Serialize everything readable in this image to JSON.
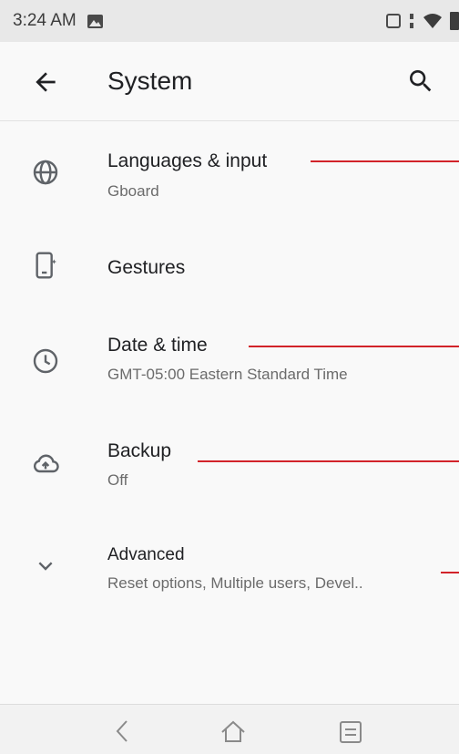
{
  "status_bar": {
    "time": "3:24 AM",
    "icons": [
      "image-notification-icon",
      "nfc-icon",
      "data-sync-icon",
      "wifi-icon",
      "battery-icon"
    ]
  },
  "app_bar": {
    "title": "System",
    "back_icon": "arrow-left-icon",
    "search_icon": "search-icon"
  },
  "settings": {
    "items": [
      {
        "icon": "globe-icon",
        "title": "Languages & input",
        "subtitle": "Gboard"
      },
      {
        "icon": "gestures-phone-icon",
        "title": "Gestures",
        "subtitle": ""
      },
      {
        "icon": "clock-icon",
        "title": "Date & time",
        "subtitle": "GMT-05:00 Eastern Standard Time"
      },
      {
        "icon": "cloud-upload-icon",
        "title": "Backup",
        "subtitle": "Off"
      },
      {
        "icon": "chevron-down-icon",
        "title": "Advanced",
        "subtitle": "Reset options, Multiple users, Devel.."
      }
    ]
  },
  "nav_bar": {
    "buttons": [
      "back-nav-icon",
      "home-nav-icon",
      "recents-nav-icon"
    ]
  },
  "colors": {
    "annotation_line": "#d2232a",
    "background": "#f9f9f9",
    "status_bar": "#e8e8e8"
  }
}
